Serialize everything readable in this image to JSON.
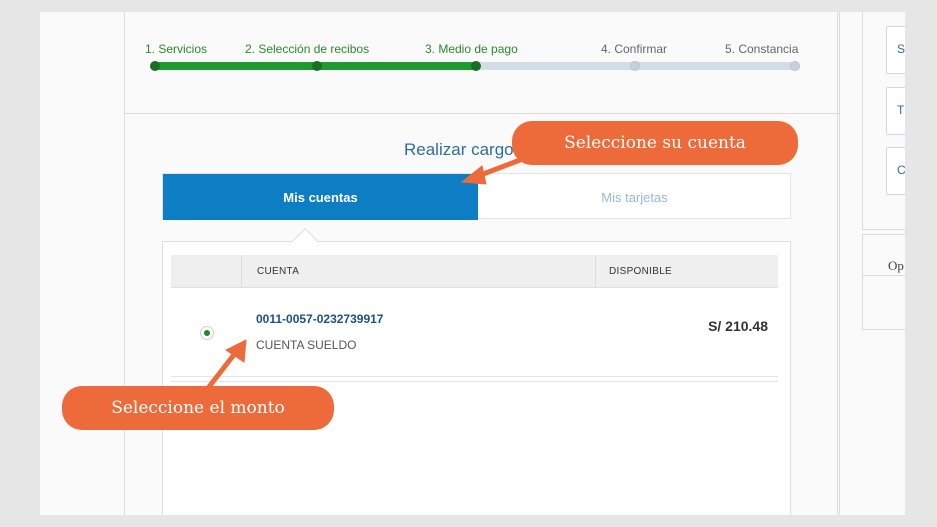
{
  "stepper": {
    "steps": [
      {
        "label": "1. Servicios",
        "done": true
      },
      {
        "label": "2. Selección de recibos",
        "done": true
      },
      {
        "label": "3. Medio de pago",
        "done": true
      },
      {
        "label": "4. Confirmar",
        "done": false
      },
      {
        "label": "5. Constancia",
        "done": false
      }
    ]
  },
  "main": {
    "title": "Realizar cargo",
    "tabs": [
      {
        "label": "Mis cuentas",
        "active": true
      },
      {
        "label": "Mis tarjetas",
        "active": false
      }
    ],
    "table": {
      "headers": [
        "CUENTA",
        "DISPONIBLE"
      ],
      "rows": [
        {
          "selected": true,
          "account_number": "0011-0057-0232739917",
          "account_type": "CUENTA SUELDO",
          "available": "S/ 210.48"
        }
      ]
    }
  },
  "sidebar": {
    "boxes": [
      "S",
      "T",
      "C"
    ],
    "card_label": "Op"
  },
  "callouts": {
    "select_account": "Seleccione su cuenta",
    "select_amount": "Seleccione el monto"
  },
  "colors": {
    "accent_blue": "#0e7ec4",
    "progress_green": "#1e9a2e",
    "callout_orange": "#ed6b3a"
  }
}
